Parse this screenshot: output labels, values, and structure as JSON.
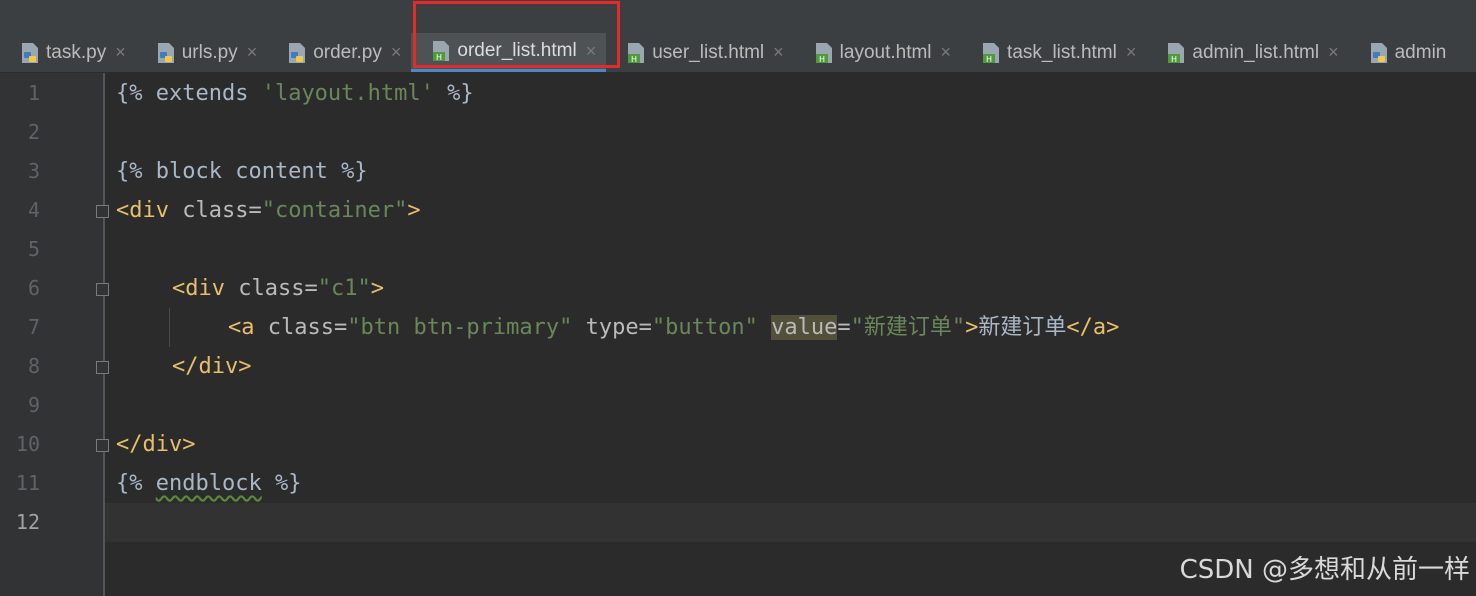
{
  "tabs": [
    {
      "label": "task.py",
      "icon": "python-file-icon",
      "active": false,
      "closable": true
    },
    {
      "label": "urls.py",
      "icon": "python-file-icon",
      "active": false,
      "closable": true
    },
    {
      "label": "order.py",
      "icon": "python-file-icon",
      "active": false,
      "closable": true
    },
    {
      "label": "order_list.html",
      "icon": "html-file-icon",
      "active": true,
      "closable": true
    },
    {
      "label": "user_list.html",
      "icon": "html-file-icon",
      "active": false,
      "closable": true
    },
    {
      "label": "layout.html",
      "icon": "html-file-icon",
      "active": false,
      "closable": true
    },
    {
      "label": "task_list.html",
      "icon": "html-file-icon",
      "active": false,
      "closable": true
    },
    {
      "label": "admin_list.html",
      "icon": "html-file-icon",
      "active": false,
      "closable": true
    },
    {
      "label": "admin",
      "icon": "python-file-icon",
      "active": false,
      "closable": false
    }
  ],
  "close_glyph": "×",
  "line_numbers": [
    "1",
    "2",
    "3",
    "4",
    "5",
    "6",
    "7",
    "8",
    "9",
    "10",
    "11",
    "12"
  ],
  "current_line": 12,
  "code": {
    "l1": {
      "a": "{% extends ",
      "b": "'layout.html'",
      "c": " %}"
    },
    "l3": {
      "a": "{% block content %}"
    },
    "l4": {
      "a": "<div",
      "b": " class=",
      "c": "\"container\"",
      "d": ">"
    },
    "l6": {
      "a": "<div",
      "b": " class=",
      "c": "\"c1\"",
      "d": ">"
    },
    "l7": {
      "a": "<a",
      "b": " class=",
      "c": "\"btn btn-primary\"",
      "d": " type=",
      "e": "\"button\"",
      "f": " ",
      "g": "value",
      "h": "=",
      "i": "\"新建订单\"",
      "j": ">",
      "k": "新建订单",
      "l": "</a>"
    },
    "l8": {
      "a": "</div>"
    },
    "l10": {
      "a": "</div>"
    },
    "l11": {
      "a": "{% ",
      "b": "endblock",
      "c": " %}"
    }
  },
  "watermark": "CSDN @多想和从前一样",
  "colors": {
    "editor_bg": "#2b2b2b",
    "gutter_bg": "#313335",
    "tab_bar_bg": "#3c3f41",
    "tag": "#e8bf6a",
    "string": "#6a8759",
    "plain": "#a9b7c6",
    "highlight_box": "#e22b2b"
  }
}
